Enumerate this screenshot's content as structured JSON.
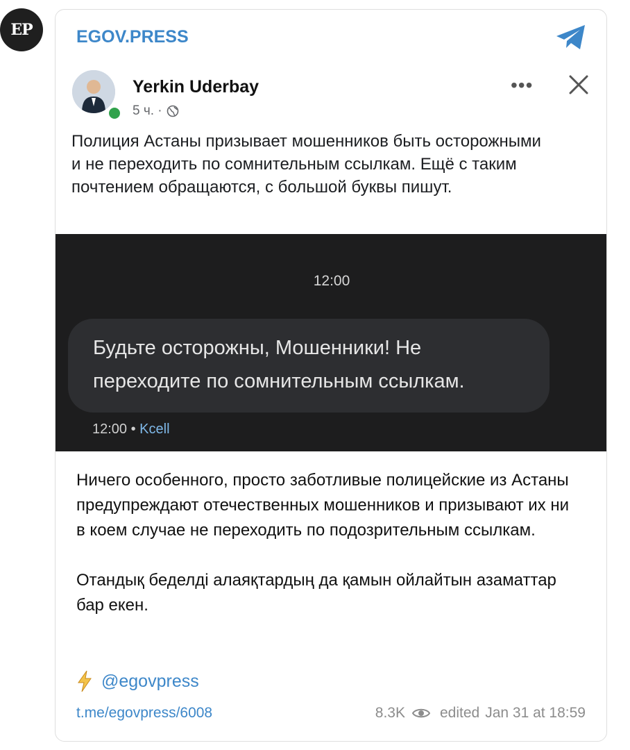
{
  "channel": {
    "avatar_text": "EP",
    "name": "EGOV.PRESS"
  },
  "fb_post": {
    "author": "Yerkin Uderbay",
    "time": "5 ч. ·",
    "text": "Полиция Астаны призывает мошенников быть осторожными и не переходить по сомнительным ссылкам. Ещё с таким почтением обращаются, с большой буквы пишут.",
    "sms": {
      "time_header": "12:00",
      "message": "Будьте осторожны, Мошенники! Не переходите по сомнительным ссылкам.",
      "footer_time": "12:00 •",
      "carrier": "Kcell"
    }
  },
  "post": {
    "paragraph_1": "Ничего особенного, просто заботливые полицейские из Астаны предупреждают отечественных мошенников и призывают их ни в коем случае не переходить по подозрительным ссылкам.",
    "paragraph_2": "Отандық беделді алаяқтардың да қамын ойлайтын азаматтар бар екен.",
    "channel_handle": "@egovpress"
  },
  "footer": {
    "url": "t.me/egovpress/6008",
    "views": "8.3K",
    "edited_label": "edited",
    "date": "Jan 31 at 18:59"
  },
  "colors": {
    "link": "#3d87c9",
    "sms_background": "#1d1d1e",
    "online": "#31a24c"
  }
}
